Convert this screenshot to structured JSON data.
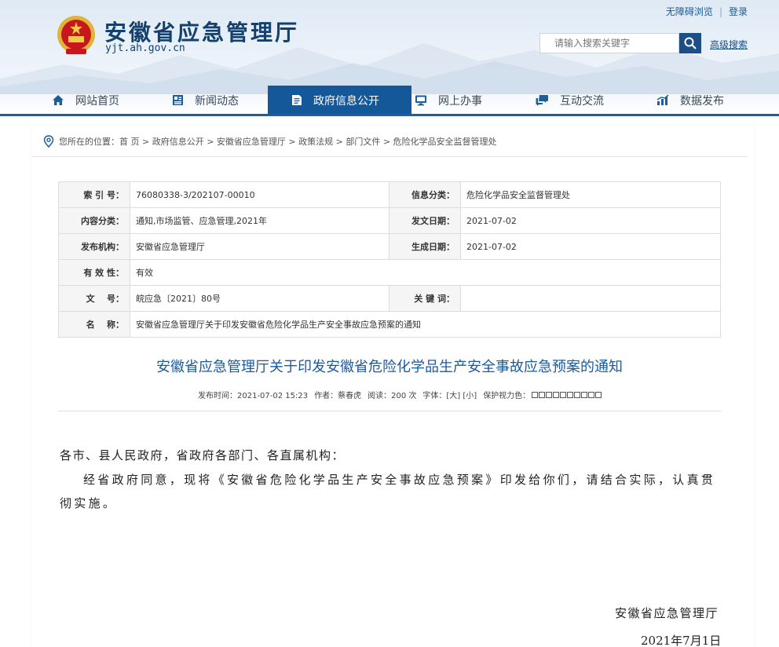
{
  "header": {
    "site_title": "安徽省应急管理厅",
    "site_domain": "yjt.ah.gov.cn",
    "top_links": {
      "accessible": "无障碍浏览",
      "login": "登录"
    },
    "search": {
      "placeholder": "请输入搜索关键字",
      "advanced": "高级搜索"
    }
  },
  "nav": {
    "items": [
      {
        "label": "网站首页",
        "icon": "home-icon"
      },
      {
        "label": "新闻动态",
        "icon": "news-icon"
      },
      {
        "label": "政府信息公开",
        "icon": "document-icon",
        "active": true
      },
      {
        "label": "网上办事",
        "icon": "monitor-icon"
      },
      {
        "label": "互动交流",
        "icon": "chat-icon"
      },
      {
        "label": "数据发布",
        "icon": "chart-icon"
      }
    ]
  },
  "breadcrumb": {
    "text": "您所在的位置：首 页 > 政府信息公开 > 安徽省应急管理厅 > 政策法规 > 部门文件 > 危险化学品安全监督管理处"
  },
  "meta": {
    "index_label": "索 引 号：",
    "index_value": "76080338-3/202107-00010",
    "category_label": "信息分类：",
    "category_value": "危险化学品安全监督管理处",
    "content_label": "内容分类：",
    "content_value": "通知,市场监管、应急管理,2021年",
    "issue_date_label": "发文日期：",
    "issue_date_value": "2021-07-02",
    "publisher_label": "发布机构：",
    "publisher_value": "安徽省应急管理厅",
    "generate_date_label": "生成日期：",
    "generate_date_value": "2021-07-02",
    "validity_label": "有 效 性：",
    "validity_value": "有效",
    "doc_no_label": "文    号：",
    "doc_no_value": "皖应急〔2021〕80号",
    "keywords_label": "关 键 词：",
    "keywords_value": "",
    "name_label": "名    称：",
    "name_value": "安徽省应急管理厅关于印发安徽省危险化学品生产安全事故应急预案的通知"
  },
  "article": {
    "title": "安徽省应急管理厅关于印发安徽省危险化学品生产安全事故应急预案的通知",
    "publish_time": "发布时间：2021-07-02 15:23",
    "author": "作者：蔡春虎",
    "views": "阅读：200 次",
    "font_size": "字体：[大] [小]",
    "eye_protect": "保护视力色：",
    "salutation": "各市、县人民政府，省政府各部门、各直属机构：",
    "body": "经省政府同意，现将《安徽省危险化学品生产安全事故应急预案》印发给你们，请结合实际，认真贯彻实施。",
    "sign_org": "安徽省应急管理厅",
    "sign_date": "2021年7月1日"
  },
  "colors": {
    "brand": "#14589a",
    "title": "#1a5ba0",
    "header_text": "#14406e"
  }
}
